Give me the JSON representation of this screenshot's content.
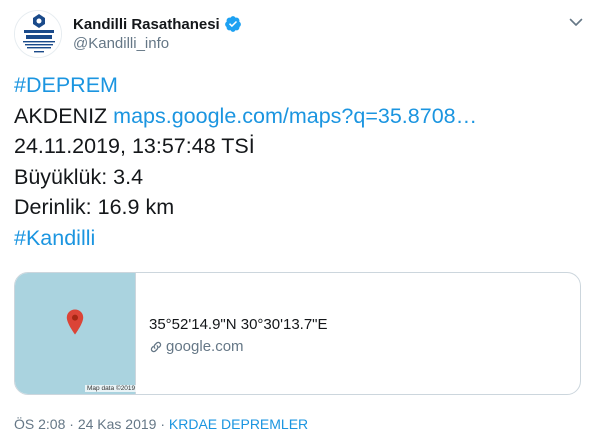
{
  "user": {
    "name": "Kandilli Rasathanesi",
    "handle": "@Kandilli_info",
    "avatar": {
      "title": "KANDİLLİ",
      "subtitle": "RASATHANESİ ve DEPREM ARAŞTIRMA ENSTİTÜSÜ"
    }
  },
  "tweet": {
    "hashtag1": "#DEPREM",
    "location": "AKDENIZ",
    "link": "maps.google.com/maps?q=35.8708…",
    "datetime": "24.11.2019, 13:57:48 TSİ",
    "magnitude": "Büyüklük: 3.4",
    "depth": "Derinlik: 16.9 km",
    "hashtag2": "#Kandilli"
  },
  "card": {
    "map_credit": "Map data ©2019",
    "title": "35°52'14.9\"N 30°30'13.7\"E",
    "domain": "google.com"
  },
  "meta": {
    "time": "ÖS 2:08",
    "date": "24 Kas 2019",
    "separator": "·",
    "source": "KRDAE DEPREMLER"
  },
  "colors": {
    "link": "#1b95e0",
    "muted": "#657786",
    "map_water": "#aad3df",
    "pin": "#db4437"
  }
}
